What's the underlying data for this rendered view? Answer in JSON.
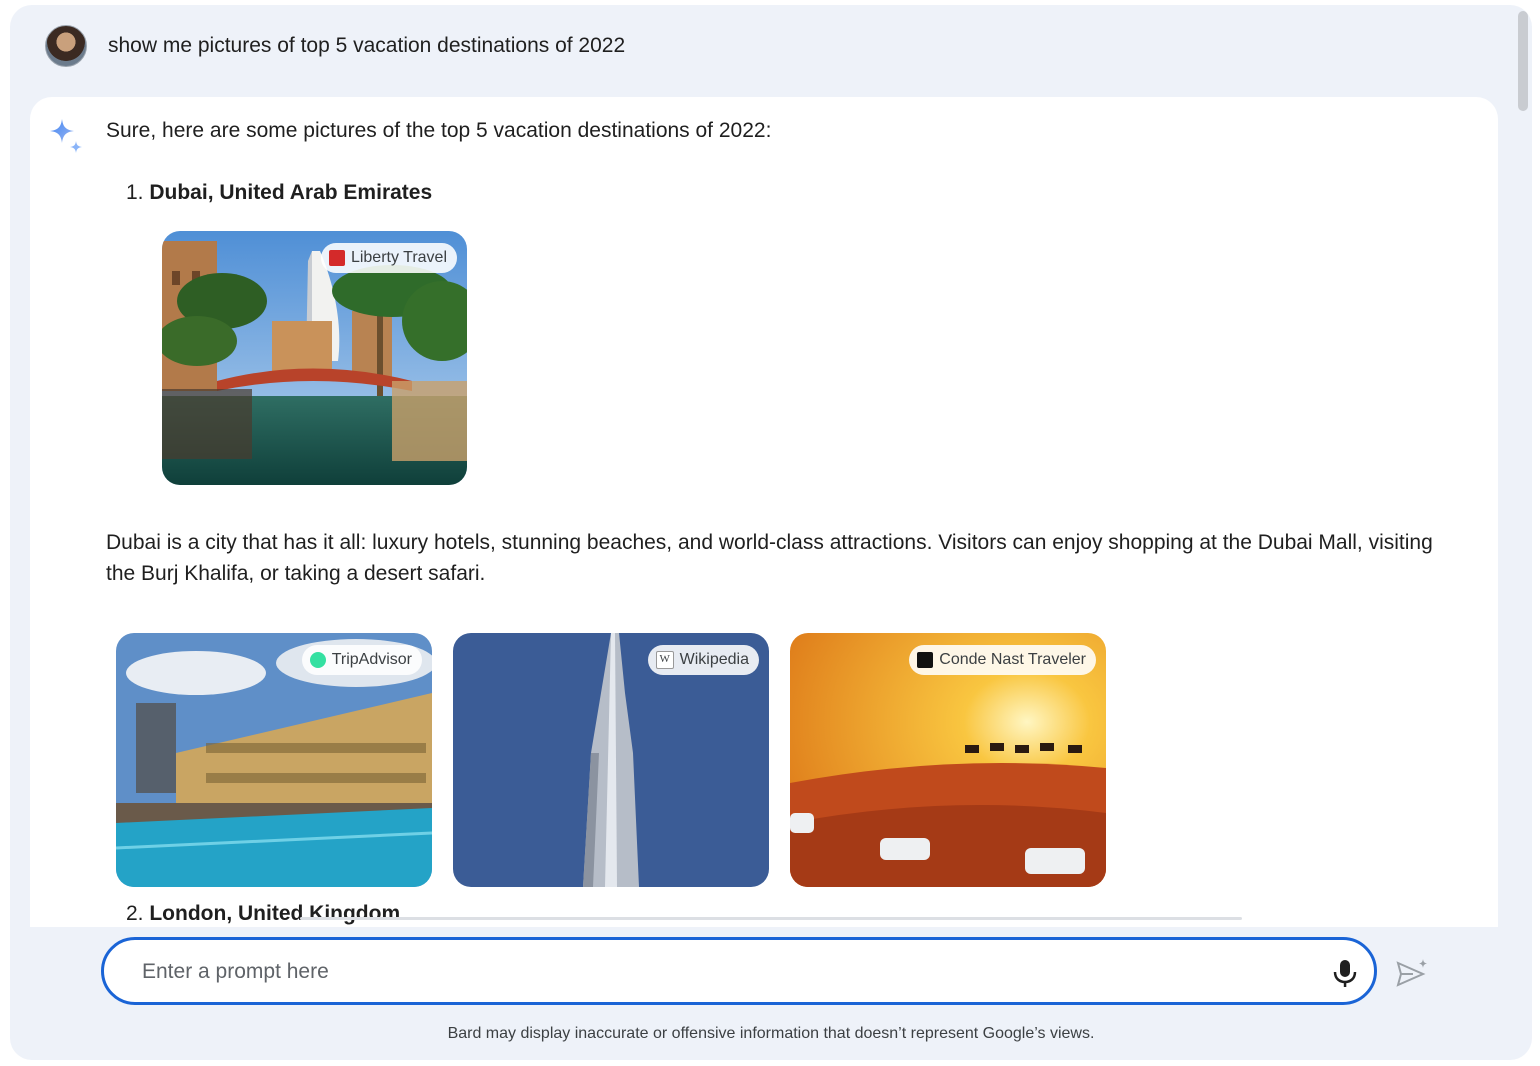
{
  "user_prompt": "show me pictures of top 5 vacation destinations of 2022",
  "response": {
    "intro": "Sure, here are some pictures of the top 5 vacation destinations of 2022:",
    "items": [
      {
        "number": "1.",
        "title": "Dubai, United Arab Emirates"
      },
      {
        "number": "2.",
        "title": "London, United Kingdom"
      }
    ],
    "main_image": {
      "source": "Liberty Travel"
    },
    "description": "Dubai is a city that has it all: luxury hotels, stunning beaches, and world-class attractions. Visitors can enjoy shopping at the Dubai Mall, visiting the Burj Khalifa, or taking a desert safari.",
    "gallery": [
      {
        "source": "TripAdvisor",
        "icon": "tripadvisor-logo"
      },
      {
        "source": "Wikipedia",
        "icon": "wikipedia-logo"
      },
      {
        "source": "Conde Nast Traveler",
        "icon": "cnt-logo"
      }
    ]
  },
  "input": {
    "placeholder": "Enter a prompt here",
    "value": ""
  },
  "disclaimer": "Bard may display inaccurate or offensive information that doesn’t represent Google’s views.",
  "colors": {
    "accent": "#1a64d6",
    "background": "#eef2f9",
    "spark": "#8ab4f8"
  }
}
